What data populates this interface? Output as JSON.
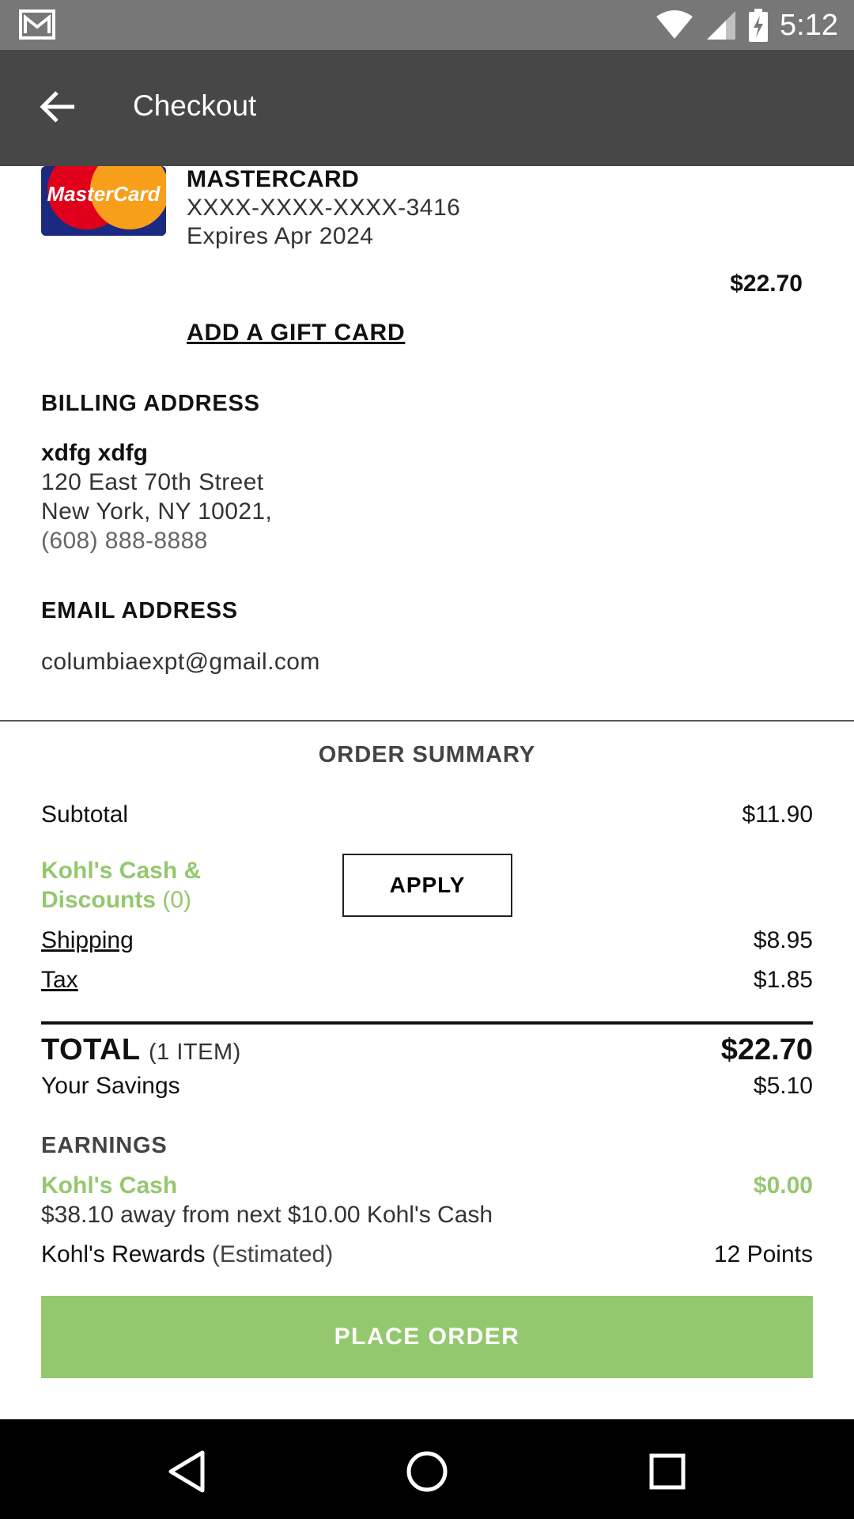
{
  "status_bar": {
    "time": "5:12",
    "icons": [
      "gmail-icon",
      "wifi-icon",
      "cellular-signal-icon",
      "battery-charging-icon"
    ]
  },
  "app_bar": {
    "title": "Checkout",
    "back_icon": "arrow-left-icon"
  },
  "payment": {
    "card_brand_logo_text": "MasterCard",
    "card_name": "MASTERCARD",
    "card_number": "XXXX-XXXX-XXXX-3416",
    "expiry": "Expires Apr 2024",
    "amount": "$22.70",
    "add_gift_card_label": "ADD A GIFT CARD"
  },
  "billing": {
    "heading": "BILLING ADDRESS",
    "name": "xdfg xdfg",
    "street": "120 East 70th Street",
    "city_line": "New York, NY 10021,",
    "phone": "(608) 888-8888"
  },
  "email": {
    "heading": "EMAIL ADDRESS",
    "value": "columbiaexpt@gmail.com"
  },
  "order_summary": {
    "title": "ORDER SUMMARY",
    "subtotal_label": "Subtotal",
    "subtotal_value": "$11.90",
    "kohls_cash_line1": "Kohl's Cash &",
    "kohls_cash_line2": "Discounts",
    "kohls_cash_count": "(0)",
    "apply_label": "APPLY",
    "shipping_label": "Shipping",
    "shipping_value": "$8.95",
    "tax_label": "Tax",
    "tax_value": "$1.85",
    "total_label": "TOTAL",
    "total_items": "(1 ITEM)",
    "total_value": "$22.70",
    "savings_label": "Your Savings",
    "savings_value": "$5.10"
  },
  "earnings": {
    "heading": "EARNINGS",
    "kohls_cash_label": "Kohl's Cash",
    "kohls_cash_value": "$0.00",
    "kohls_cash_note": "$38.10 away from next $10.00 Kohl's Cash",
    "rewards_label": "Kohl's Rewards",
    "rewards_estimated": "(Estimated)",
    "rewards_value": "12 Points"
  },
  "place_order_label": "PLACE ORDER",
  "colors": {
    "status_bar": "#777777",
    "app_bar": "#474747",
    "accent_green": "#94c86e",
    "nav_bar": "#000000"
  },
  "nav": {
    "icons": [
      "back-triangle-icon",
      "home-circle-icon",
      "recents-square-icon"
    ]
  }
}
